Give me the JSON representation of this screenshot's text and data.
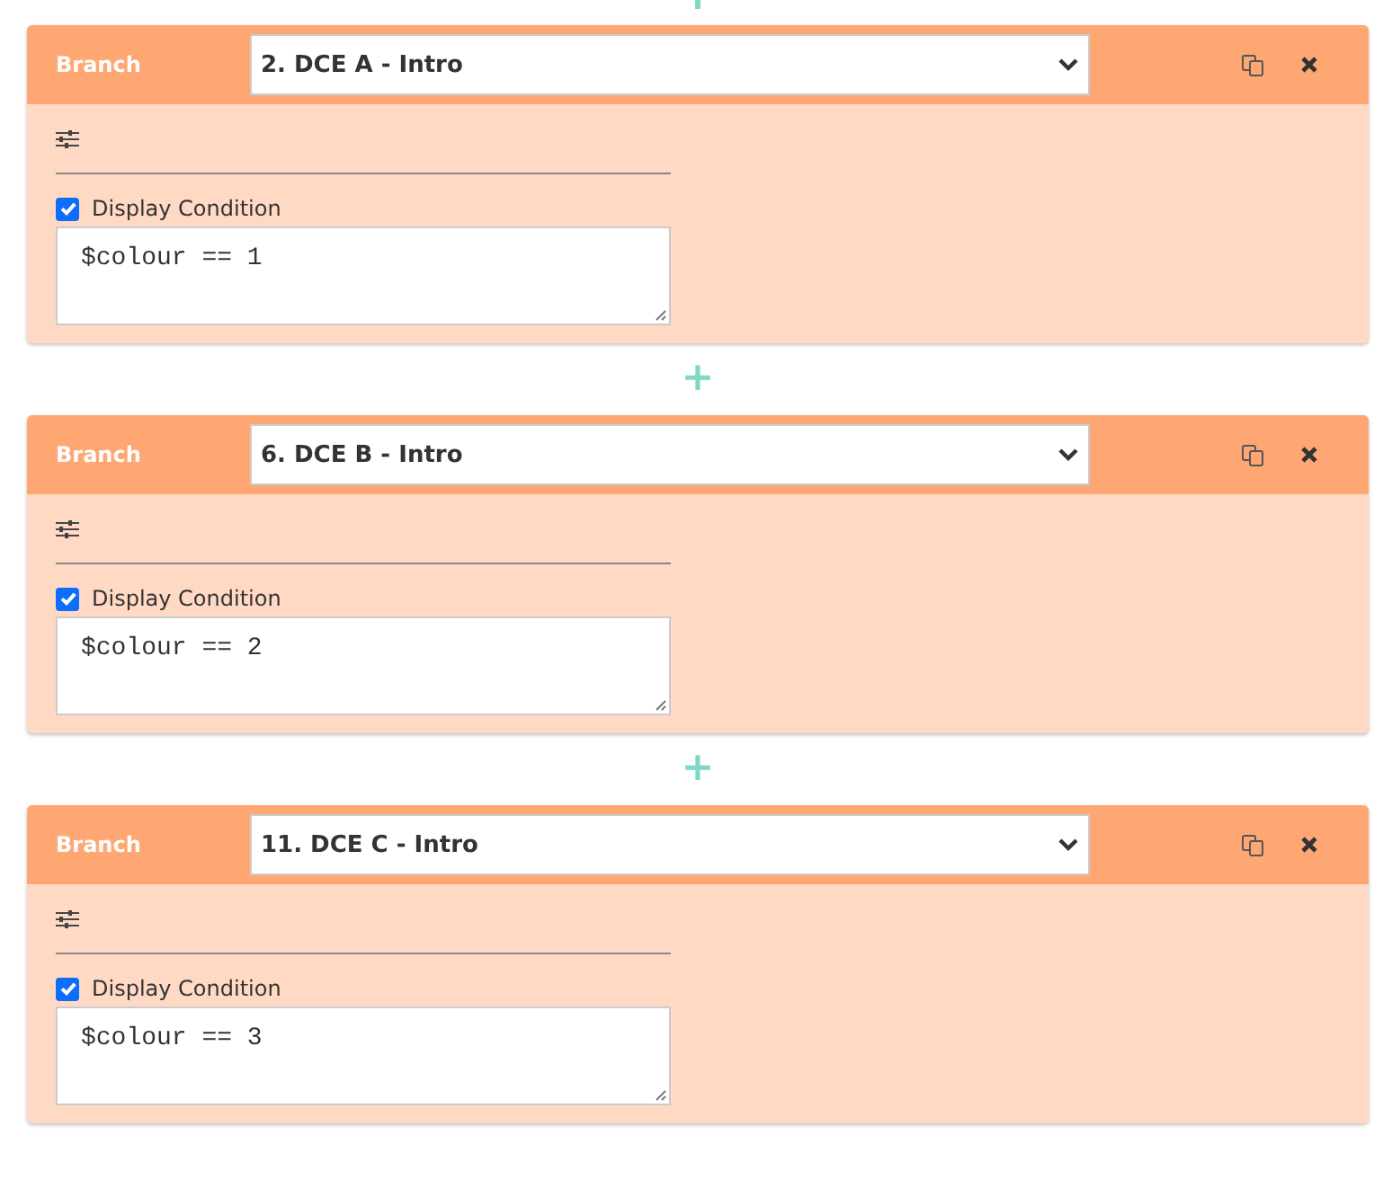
{
  "branches": [
    {
      "title": "Branch",
      "target": "2. DCE A - Intro",
      "display_condition": {
        "label": "Display Condition",
        "checked": true
      },
      "condition": "$colour == 1"
    },
    {
      "add_label": "+",
      "title": "Branch",
      "target": "6. DCE B - Intro",
      "display_condition": {
        "label": "Display Condition",
        "checked": true
      },
      "condition": "$colour == 2"
    },
    {
      "add_label": "+",
      "title": "Branch",
      "target": "11. DCE C - Intro",
      "display_condition": {
        "label": "Display Condition",
        "checked": true
      },
      "condition": "$colour == 3"
    }
  ]
}
